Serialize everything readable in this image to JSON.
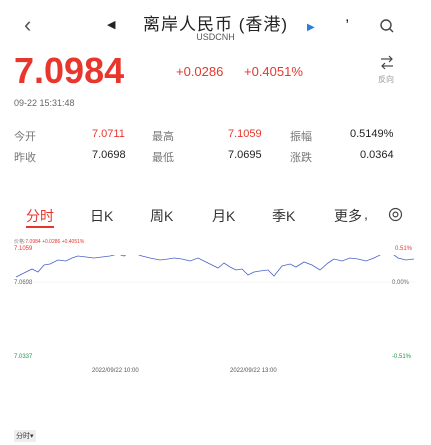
{
  "header": {
    "back_icon": "chevron-left",
    "prev_icon": "triangle-left",
    "next_icon": "triangle-right",
    "title": "离岸人民币 (香港)",
    "subtitle": "USDCNH",
    "title_suffix": ",",
    "search_icon": "search"
  },
  "quote": {
    "price": "7.0984",
    "change": "+0.0286",
    "change_pct": "+0.4051%",
    "swap_label": "反向",
    "timestamp": "09-22 15:31:48"
  },
  "stats": [
    {
      "label": "今开",
      "value": "7.0711"
    },
    {
      "label": "最高",
      "value": "7.1059"
    },
    {
      "label": "振幅",
      "value": "0.5149%"
    },
    {
      "label": "昨收",
      "value": "7.0698"
    },
    {
      "label": "最低",
      "value": "7.0695"
    },
    {
      "label": "涨跌",
      "value": "0.0364"
    }
  ],
  "tabs": [
    {
      "label": "分时",
      "active": true
    },
    {
      "label": "日K"
    },
    {
      "label": "周K"
    },
    {
      "label": "月K"
    },
    {
      "label": "季K"
    },
    {
      "label": "更多"
    }
  ],
  "tabs_extra": ",",
  "chart": {
    "legend_name": "价格:",
    "legend_price": "7.0984",
    "legend_change": "+0.0286",
    "legend_pct": "+0.4051%",
    "y_top": "7.1059",
    "y_mid": "7.0698",
    "y_bottom": "7.0337",
    "pct_top": "0.51%",
    "pct_mid": "0.00%",
    "pct_bottom": "-0.51%",
    "date_left": "2022/09/22 10:00",
    "date_right": "2022/09/22 13:00",
    "bottom_tag": "分时▾"
  },
  "colors": {
    "up": "#e8362d",
    "down": "#1a9a4a",
    "line": "#4a62c9"
  }
}
